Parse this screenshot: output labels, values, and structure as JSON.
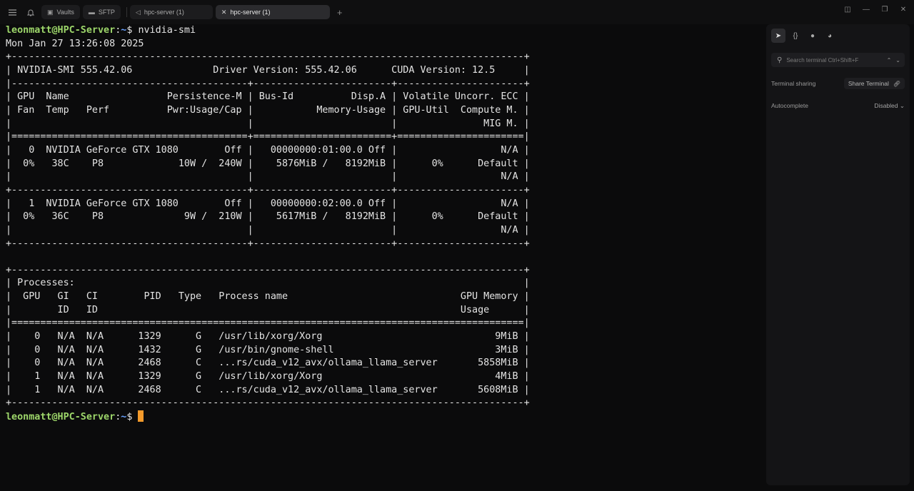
{
  "topbar": {
    "tabs": [
      {
        "label": "Vaults",
        "icon": "vault-icon",
        "active": false
      },
      {
        "label": "SFTP",
        "icon": "folder-icon",
        "active": false
      },
      {
        "label": "hpc-server (1)",
        "icon": "back-icon",
        "active": false
      },
      {
        "label": "hpc-server (1)",
        "icon": "close-icon",
        "active": true
      }
    ]
  },
  "terminal": {
    "user": "leonmatt@HPC-Server",
    "cwd": "~",
    "command": "nvidia-smi",
    "output": [
      "Mon Jan 27 13:26:08 2025",
      "+-----------------------------------------------------------------------------------------+",
      "| NVIDIA-SMI 555.42.06              Driver Version: 555.42.06      CUDA Version: 12.5     |",
      "|-----------------------------------------+------------------------+----------------------+",
      "| GPU  Name                 Persistence-M | Bus-Id          Disp.A | Volatile Uncorr. ECC |",
      "| Fan  Temp   Perf          Pwr:Usage/Cap |           Memory-Usage | GPU-Util  Compute M. |",
      "|                                         |                        |               MIG M. |",
      "|=========================================+========================+======================|",
      "|   0  NVIDIA GeForce GTX 1080        Off |   00000000:01:00.0 Off |                  N/A |",
      "|  0%   38C    P8             10W /  240W |    5876MiB /   8192MiB |      0%      Default |",
      "|                                         |                        |                  N/A |",
      "+-----------------------------------------+------------------------+----------------------+",
      "|   1  NVIDIA GeForce GTX 1080        Off |   00000000:02:00.0 Off |                  N/A |",
      "|  0%   36C    P8              9W /  210W |    5617MiB /   8192MiB |      0%      Default |",
      "|                                         |                        |                  N/A |",
      "+-----------------------------------------+------------------------+----------------------+",
      "",
      "+-----------------------------------------------------------------------------------------+",
      "| Processes:                                                                              |",
      "|  GPU   GI   CI        PID   Type   Process name                              GPU Memory |",
      "|        ID   ID                                                               Usage      |",
      "|=========================================================================================|",
      "|    0   N/A  N/A      1329      G   /usr/lib/xorg/Xorg                              9MiB |",
      "|    0   N/A  N/A      1432      G   /usr/bin/gnome-shell                            3MiB |",
      "|    0   N/A  N/A      2468      C   ...rs/cuda_v12_avx/ollama_llama_server       5858MiB |",
      "|    1   N/A  N/A      1329      G   /usr/lib/xorg/Xorg                              4MiB |",
      "|    1   N/A  N/A      2468      C   ...rs/cuda_v12_avx/ollama_llama_server       5608MiB |",
      "+-----------------------------------------------------------------------------------------+"
    ]
  },
  "panel": {
    "search_placeholder": "Search terminal  Ctrl+Shift+F",
    "terminal_sharing_label": "Terminal sharing",
    "share_button": "Share Terminal",
    "autocomplete_label": "Autocomplete",
    "autocomplete_value": "Disabled"
  }
}
